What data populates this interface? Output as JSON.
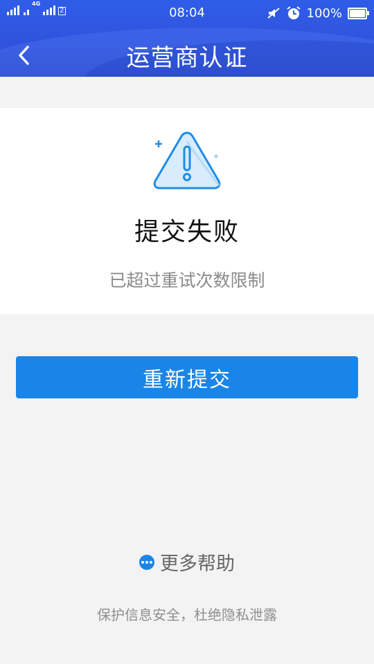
{
  "statusbar": {
    "network": "4G",
    "sim_label": "2",
    "time": "08:04",
    "battery": "100%"
  },
  "header": {
    "title": "运营商认证",
    "back_icon": "chevron-left-icon"
  },
  "result": {
    "icon": "warning-triangle-icon",
    "title": "提交失败",
    "description": "已超过重试次数限制"
  },
  "actions": {
    "resubmit_label": "重新提交"
  },
  "help": {
    "icon": "more-dots-icon",
    "label": "更多帮助"
  },
  "footer": {
    "note": "保护信息安全，杜绝隐私泄露"
  },
  "colors": {
    "header_blue": "#2f5de8",
    "primary_button": "#1a85e6",
    "icon_fill": "#d8ecfb",
    "icon_stroke": "#1f8be6"
  }
}
